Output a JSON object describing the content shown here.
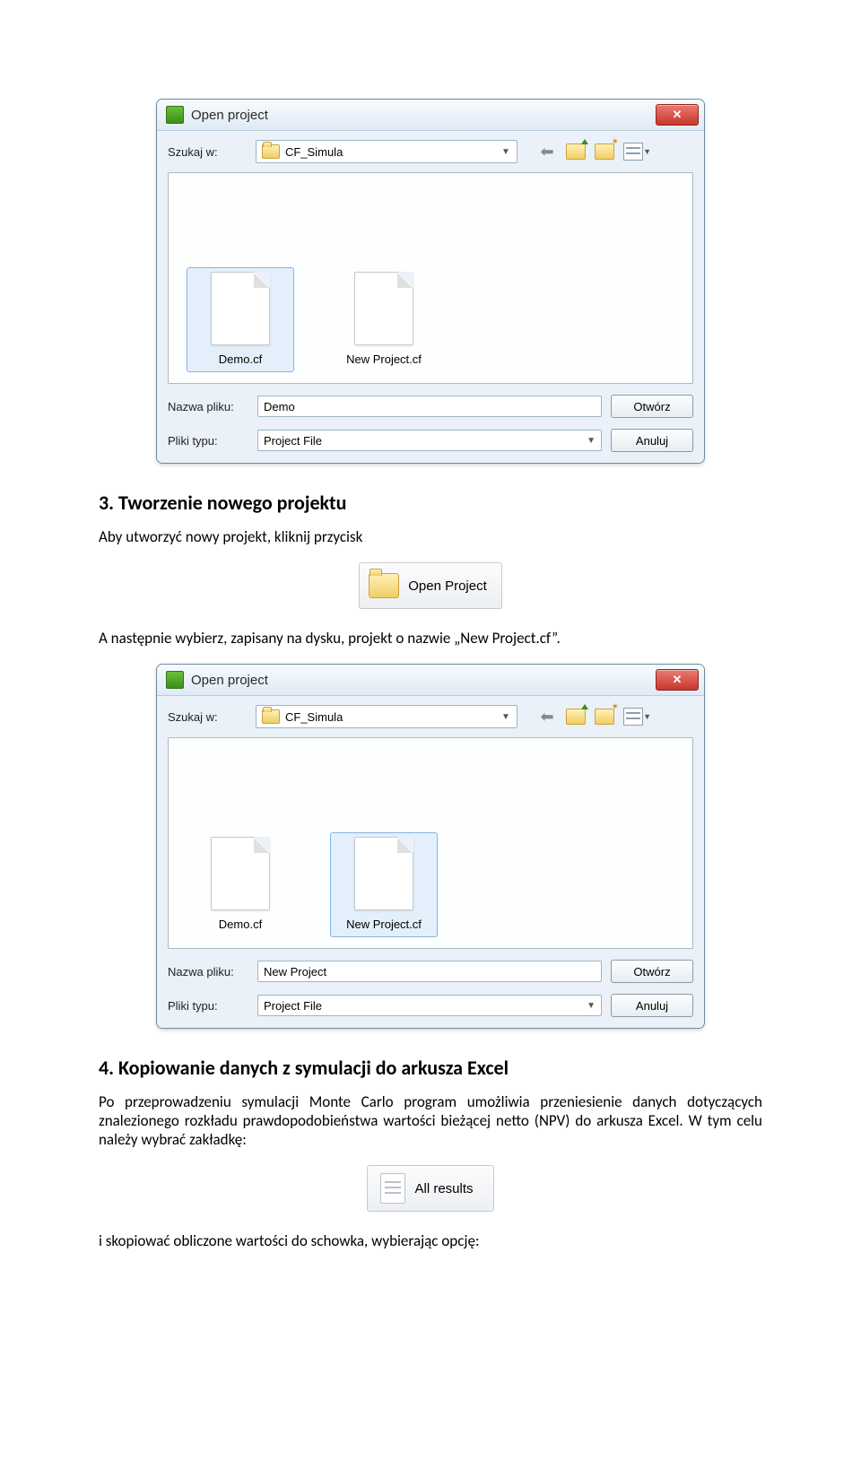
{
  "dialog1": {
    "title": "Open project",
    "lookin_label": "Szukaj w:",
    "folder": "CF_Simula",
    "files": [
      "Demo.cf",
      "New Project.cf"
    ],
    "selected_index": 0,
    "filename_label": "Nazwa pliku:",
    "filename_value": "Demo",
    "filetype_label": "Pliki typu:",
    "filetype_value": "Project File",
    "open_btn": "Otwórz",
    "cancel_btn": "Anuluj"
  },
  "section3": {
    "heading": "3. Tworzenie nowego projektu",
    "p1": "Aby utworzyć nowy projekt, kliknij przycisk",
    "open_project_btn": "Open Project",
    "p2": "A następnie wybierz, zapisany na dysku, projekt o nazwie „New Project.cf”."
  },
  "dialog2": {
    "title": "Open project",
    "lookin_label": "Szukaj w:",
    "folder": "CF_Simula",
    "files": [
      "Demo.cf",
      "New Project.cf"
    ],
    "selected_index": 1,
    "filename_label": "Nazwa pliku:",
    "filename_value": "New Project",
    "filetype_label": "Pliki typu:",
    "filetype_value": "Project File",
    "open_btn": "Otwórz",
    "cancel_btn": "Anuluj"
  },
  "section4": {
    "heading": "4. Kopiowanie danych z symulacji do arkusza Excel",
    "p1": "Po przeprowadzeniu symulacji Monte Carlo program umożliwia przeniesienie danych dotyczących znalezionego rozkładu prawdopodobieństwa wartości bieżącej netto (NPV) do arkusza Excel. W tym celu należy wybrać zakładkę:",
    "all_results_btn": "All results",
    "p2": "i skopiować obliczone wartości do schowka, wybierając opcję:"
  }
}
